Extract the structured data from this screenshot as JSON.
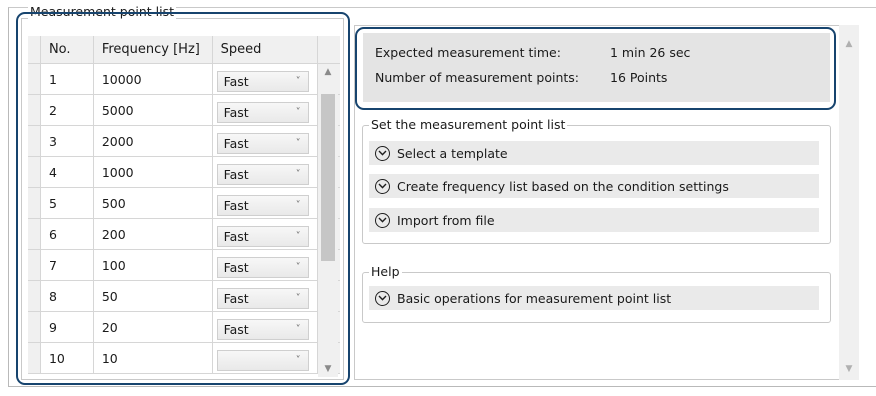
{
  "measurement_list": {
    "group_label": "Measurement point list",
    "columns": [
      "No.",
      "Frequency [Hz]",
      "Speed"
    ],
    "rows": [
      {
        "no": "1",
        "frequency": "10000",
        "speed": "Fast"
      },
      {
        "no": "2",
        "frequency": "5000",
        "speed": "Fast"
      },
      {
        "no": "3",
        "frequency": "2000",
        "speed": "Fast"
      },
      {
        "no": "4",
        "frequency": "1000",
        "speed": "Fast"
      },
      {
        "no": "5",
        "frequency": "500",
        "speed": "Fast"
      },
      {
        "no": "6",
        "frequency": "200",
        "speed": "Fast"
      },
      {
        "no": "7",
        "frequency": "100",
        "speed": "Fast"
      },
      {
        "no": "8",
        "frequency": "50",
        "speed": "Fast"
      },
      {
        "no": "9",
        "frequency": "20",
        "speed": "Fast"
      },
      {
        "no": "10",
        "frequency": "10",
        "speed": ""
      }
    ],
    "dropdown_icon": "chevron-down-icon"
  },
  "info": {
    "time_label": "Expected measurement time:",
    "time_value": "1 min 26 sec",
    "points_label": "Number of measurement points:",
    "points_value": "16 Points"
  },
  "set_list": {
    "group_label": "Set the measurement point list",
    "items": [
      {
        "label": "Select a template",
        "icon": "expand-circle-icon"
      },
      {
        "label": "Create frequency list based on the condition settings",
        "icon": "expand-circle-icon"
      },
      {
        "label": "Import from file",
        "icon": "expand-circle-icon"
      }
    ]
  },
  "help": {
    "group_label": "Help",
    "items": [
      {
        "label": "Basic operations for measurement point list",
        "icon": "expand-circle-icon"
      }
    ]
  },
  "colors": {
    "highlight_border": "#17446e",
    "info_panel_bg": "#e4e4e4",
    "expander_bg": "#eaeaea",
    "header_bg": "#f0f0f0"
  }
}
